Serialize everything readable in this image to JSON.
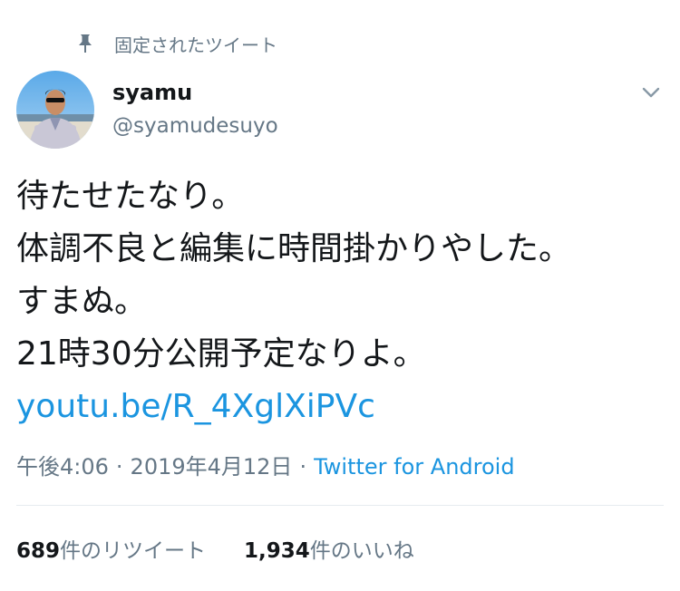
{
  "pinned": {
    "label": "固定されたツイート",
    "icon": "pin-icon"
  },
  "author": {
    "display_name": "syamu",
    "handle": "@syamudesuyo"
  },
  "tweet": {
    "lines": [
      "待たせたなり。",
      "体調不良と編集に時間掛かりやした。",
      "すまぬ。",
      "21時30分公開予定なりよ。"
    ],
    "link": "youtu.be/R_4XglXiPVc"
  },
  "meta": {
    "time": "午後4:06",
    "separator": "·",
    "date": "2019年4月12日",
    "app": "Twitter for Android"
  },
  "stats": {
    "retweet_count": "689",
    "retweet_label": "件のリツイート",
    "like_count": "1,934",
    "like_label": "件のいいね"
  },
  "colors": {
    "text": "#14171a",
    "secondary": "#657786",
    "link": "#1b95e0",
    "divider": "#e6ecf0"
  }
}
